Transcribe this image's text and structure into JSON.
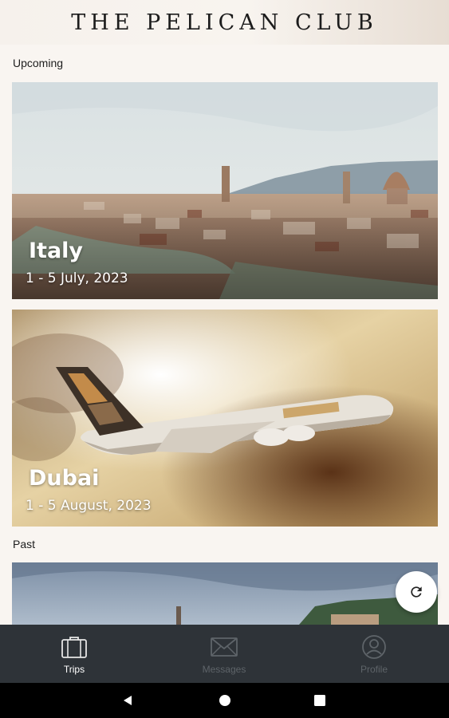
{
  "app": {
    "brand": "THE PELICAN CLUB"
  },
  "sections": {
    "upcoming": "Upcoming",
    "past": "Past"
  },
  "trips": [
    {
      "destination": "Italy",
      "dates": "1 - 5 July, 2023"
    },
    {
      "destination": "Dubai",
      "dates": "1 - 5 August, 2023"
    }
  ],
  "fab": {
    "icon": "refresh-icon"
  },
  "bottom_nav": {
    "items": [
      {
        "label": "Trips",
        "icon": "suitcase-icon",
        "active": true
      },
      {
        "label": "Messages",
        "icon": "envelope-icon",
        "active": false
      },
      {
        "label": "Profile",
        "icon": "user-circle-icon",
        "active": false
      }
    ]
  },
  "system_nav": [
    "back-icon",
    "home-icon",
    "recents-icon"
  ],
  "colors": {
    "nav_bg": "#2e3338",
    "page_bg": "#f9f5f1",
    "text": "#1d1d1d"
  }
}
